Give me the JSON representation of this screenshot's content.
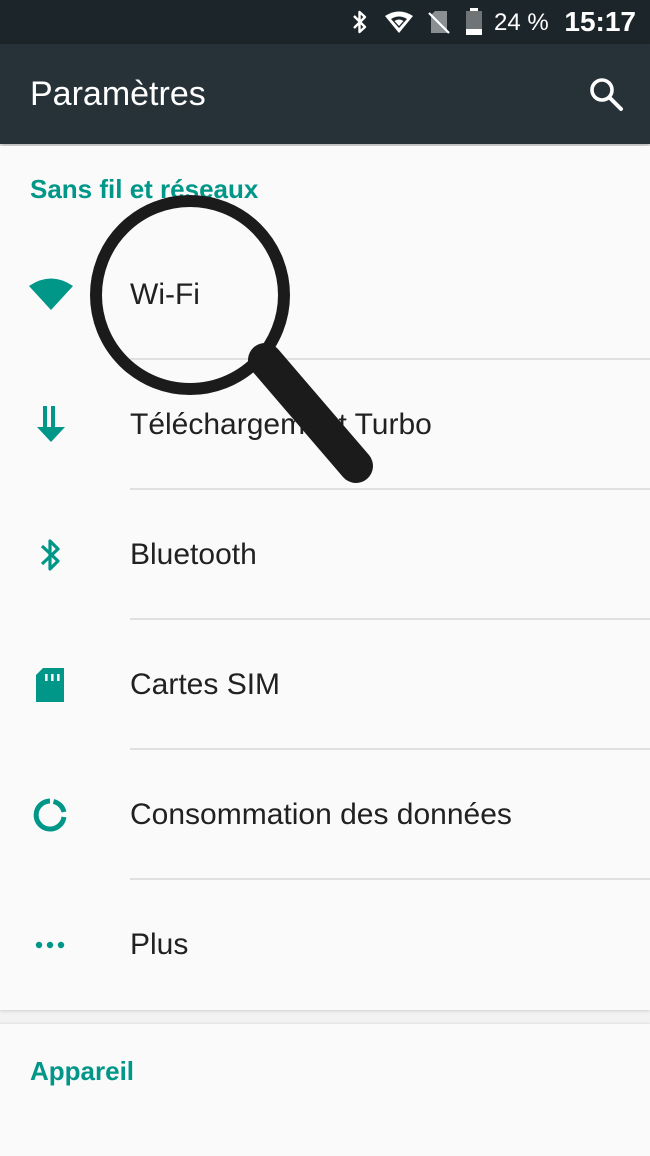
{
  "status_bar": {
    "battery": "24 %",
    "time": "15:17",
    "icons": [
      "bluetooth-icon",
      "wifi-icon",
      "no-sim-icon",
      "battery-icon"
    ]
  },
  "toolbar": {
    "title": "Paramètres",
    "search_icon": "search-icon"
  },
  "sections": {
    "wireless": {
      "header": "Sans fil et réseaux",
      "items": [
        {
          "label": "Wi-Fi",
          "icon": "wifi-icon"
        },
        {
          "label": "Téléchargement Turbo",
          "icon": "download-turbo-icon"
        },
        {
          "label": "Bluetooth",
          "icon": "bluetooth-icon"
        },
        {
          "label": "Cartes SIM",
          "icon": "sim-card-icon"
        },
        {
          "label": "Consommation des données",
          "icon": "data-usage-icon"
        },
        {
          "label": "Plus",
          "icon": "more-icon"
        }
      ]
    },
    "device": {
      "header": "Appareil"
    }
  },
  "colors": {
    "accent": "#009688",
    "toolbar": "#263238",
    "status_bar": "#1c2529"
  }
}
